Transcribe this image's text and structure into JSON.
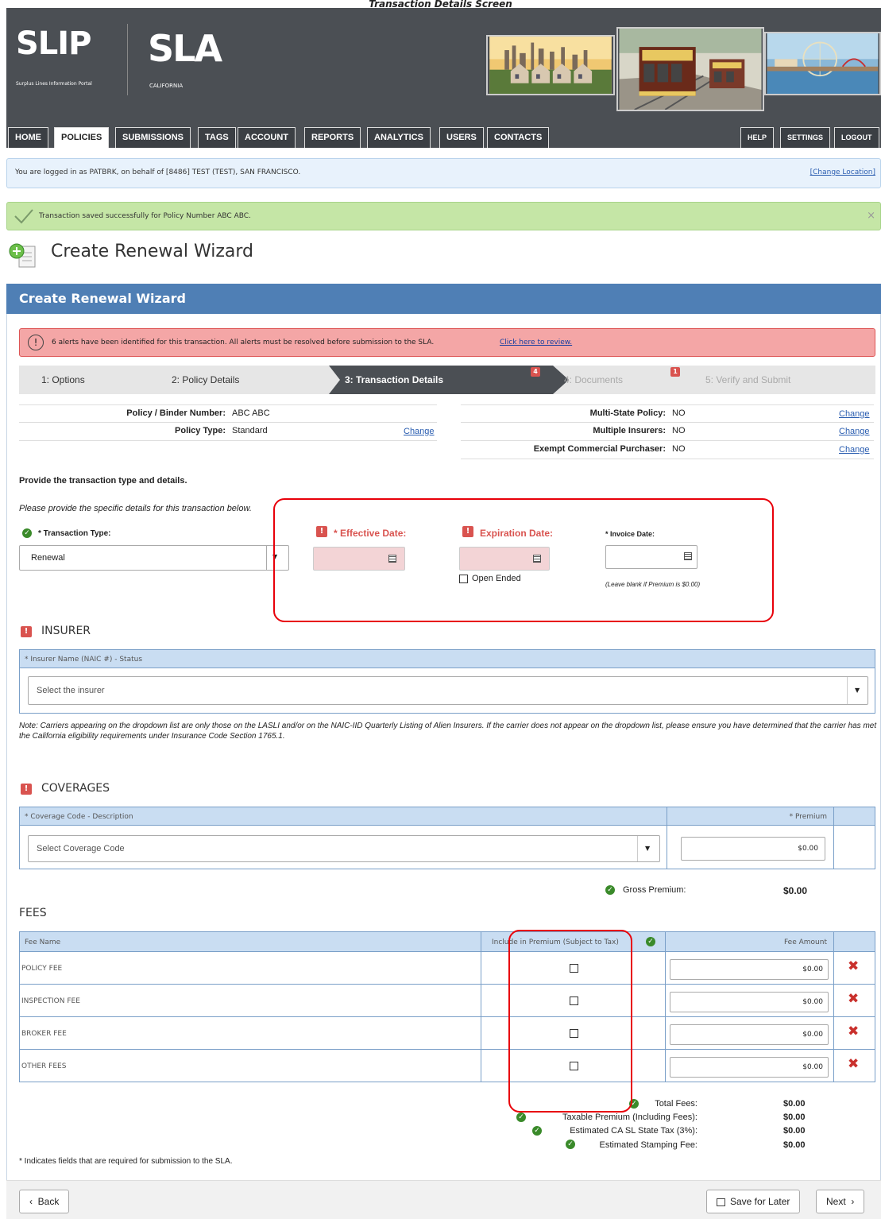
{
  "doc_title": "Transaction Details Screen",
  "logos": {
    "slip": "SLIP",
    "slip_sub": "Surplus Lines Information Portal",
    "sla": "SLA",
    "sla_sub": "CALIFORNIA"
  },
  "nav": {
    "left": [
      "HOME",
      "POLICIES",
      "SUBMISSIONS",
      "TAGS",
      "ACCOUNT",
      "REPORTS",
      "ANALYTICS",
      "USERS",
      "CONTACTS"
    ],
    "active": "POLICIES",
    "right": [
      "HELP",
      "SETTINGS",
      "LOGOUT"
    ]
  },
  "info_bar": {
    "text": "You are logged in as PATBRK, on behalf of [8486] TEST (TEST), SAN FRANCISCO.",
    "link": "[Change Location]"
  },
  "success_bar": {
    "text": "Transaction saved successfully for Policy Number ABC ABC."
  },
  "page_title": "Create Renewal Wizard",
  "wizard_header": "Create Renewal Wizard",
  "alert": {
    "text": "6 alerts have been identified for this transaction. All alerts must be resolved before submission to the SLA.",
    "link": "Click here to review."
  },
  "steps": [
    {
      "label": "1: Options"
    },
    {
      "label": "2: Policy Details"
    },
    {
      "label": "3: Transaction Details",
      "badge": "4"
    },
    {
      "label": "4: Documents",
      "badge": "1"
    },
    {
      "label": "5: Verify and Submit"
    }
  ],
  "summary_left": [
    {
      "label": "Policy / Binder Number:",
      "value": "ABC ABC",
      "link": ""
    },
    {
      "label": "Policy Type:",
      "value": "Standard",
      "link": "Change"
    }
  ],
  "summary_right": [
    {
      "label": "Multi-State Policy:",
      "value": "NO",
      "link": "Change"
    },
    {
      "label": "Multiple Insurers:",
      "value": "NO",
      "link": "Change"
    },
    {
      "label": "Exempt Commercial Purchaser:",
      "value": "NO",
      "link": "Change"
    }
  ],
  "instructions": {
    "heading": "Provide the transaction type and details.",
    "sub": "Please provide the specific details for this transaction below."
  },
  "transaction": {
    "type_label": "* Transaction Type:",
    "type_value": "Renewal",
    "effective_label": "* Effective Date:",
    "expiration_label": "Expiration Date:",
    "open_ended_label": "Open Ended",
    "invoice_label": "* Invoice Date:",
    "invoice_note": "(Leave blank if Premium is $0.00)"
  },
  "insurer": {
    "title": "INSURER",
    "column": "* Insurer Name (NAIC #) - Status",
    "placeholder": "Select the insurer",
    "note": "Note: Carriers appearing on the dropdown list are only those on the LASLI and/or on the NAIC-IID Quarterly Listing of Alien Insurers. If the carrier does not appear on the dropdown list, please ensure you have determined that the carrier has met the California eligibility requirements under Insurance Code Section 1765.1."
  },
  "coverages": {
    "title": "COVERAGES",
    "col_code": "* Coverage Code - Description",
    "col_premium": "* Premium",
    "placeholder": "Select Coverage Code",
    "premium_value": "$0.00",
    "gross_label": "Gross Premium:",
    "gross_value": "$0.00"
  },
  "fees": {
    "title": "FEES",
    "col_name": "Fee Name",
    "col_include": "Include in Premium (Subject to Tax)",
    "col_amount": "Fee Amount",
    "rows": [
      {
        "name": "POLICY FEE",
        "amount": "$0.00"
      },
      {
        "name": "INSPECTION FEE",
        "amount": "$0.00"
      },
      {
        "name": "BROKER FEE",
        "amount": "$0.00"
      },
      {
        "name": "OTHER FEES",
        "amount": "$0.00"
      }
    ]
  },
  "totals": [
    {
      "label": "Total Fees:",
      "value": "$0.00"
    },
    {
      "label": "Taxable Premium (Including Fees):",
      "value": "$0.00"
    },
    {
      "label": "Estimated CA SL State Tax (3%):",
      "value": "$0.00"
    },
    {
      "label": "Estimated Stamping Fee:",
      "value": "$0.00"
    }
  ],
  "footnote": "* Indicates fields that are required for submission to the SLA.",
  "buttons": {
    "back": "Back",
    "save": "Save for Later",
    "next": "Next"
  },
  "colors": {
    "accent_blue": "#4f7fb5",
    "alert_red": "#d9534f",
    "success_green": "#c5e6a6",
    "highlight_red": "#e8000a"
  }
}
